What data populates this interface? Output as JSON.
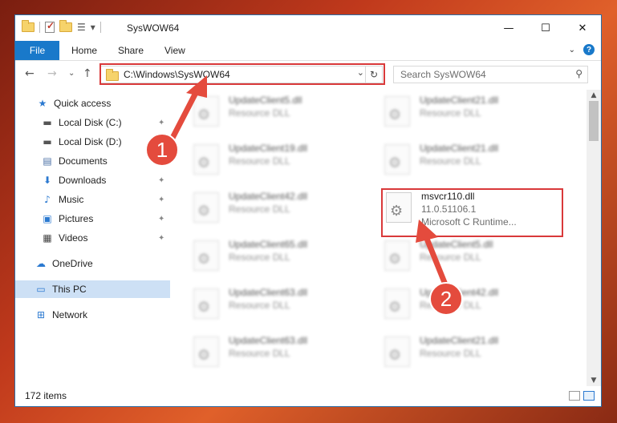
{
  "window": {
    "title": "SysWOW64",
    "caption": {
      "minimize": "—",
      "maximize": "☐",
      "close": "✕"
    },
    "qat_dropdown": "▾"
  },
  "ribbon": {
    "tabs": [
      "File",
      "Home",
      "Share",
      "View"
    ],
    "expand": "⌄",
    "help": "?"
  },
  "nav": {
    "back": "←",
    "forward": "→",
    "recent": "⌄",
    "up": "↑",
    "address": "C:\\Windows\\SysWOW64",
    "address_dropdown": "⌄",
    "refresh": "↻",
    "search_placeholder": "Search SysWOW64",
    "search_icon": "search-icon"
  },
  "sidebar": {
    "items": [
      {
        "label": "Quick access",
        "icon": "star-icon",
        "glyph": "★",
        "pinned": false
      },
      {
        "label": "Local Disk (C:)",
        "icon": "drive-icon",
        "glyph": "▬",
        "pinned": true
      },
      {
        "label": "Local Disk (D:)",
        "icon": "drive-icon",
        "glyph": "▬",
        "pinned": false
      },
      {
        "label": "Documents",
        "icon": "documents-icon",
        "glyph": "▤",
        "pinned": true
      },
      {
        "label": "Downloads",
        "icon": "download-icon",
        "glyph": "⬇",
        "pinned": true
      },
      {
        "label": "Music",
        "icon": "music-icon",
        "glyph": "♪",
        "pinned": true
      },
      {
        "label": "Pictures",
        "icon": "pictures-icon",
        "glyph": "▣",
        "pinned": true
      },
      {
        "label": "Videos",
        "icon": "videos-icon",
        "glyph": "▦",
        "pinned": true
      },
      {
        "label": "OneDrive",
        "icon": "cloud-icon",
        "glyph": "☁",
        "pinned": false
      },
      {
        "label": "This PC",
        "icon": "computer-icon",
        "glyph": "▭",
        "pinned": false,
        "selected": true
      },
      {
        "label": "Network",
        "icon": "network-icon",
        "glyph": "⊞",
        "pinned": false
      }
    ],
    "pin_glyph": "📌"
  },
  "files": [
    {
      "name": "UpdateClient5.dll",
      "type": "Resource DLL"
    },
    {
      "name": "UpdateClient21.dll",
      "type": "Resource DLL"
    },
    {
      "name": "UpdateClient19.dll",
      "type": "Resource DLL"
    },
    {
      "name": "UpdateClient21.dll",
      "type": "Resource DLL"
    },
    {
      "name": "UpdateClient42.dll",
      "type": "Resource DLL"
    },
    {
      "name": "msvcr110.dll",
      "version": "11.0.51106.1",
      "type": "Microsoft C Runtime..."
    },
    {
      "name": "UpdateClient65.dll",
      "type": "Resource DLL"
    },
    {
      "name": "UpdateClient5.dll",
      "type": "Resource DLL"
    },
    {
      "name": "UpdateClient63.dll",
      "type": "Resource DLL"
    },
    {
      "name": "UpdateClient42.dll",
      "type": "Resource DLL"
    },
    {
      "name": "UpdateClient63.dll",
      "type": "Resource DLL"
    },
    {
      "name": "UpdateClient21.dll",
      "type": "Resource DLL"
    }
  ],
  "status": {
    "item_count": "172 items"
  },
  "annotations": {
    "marker1": "1",
    "marker2": "2",
    "highlight_color": "#d9393a",
    "marker_color": "#e44b3d"
  }
}
